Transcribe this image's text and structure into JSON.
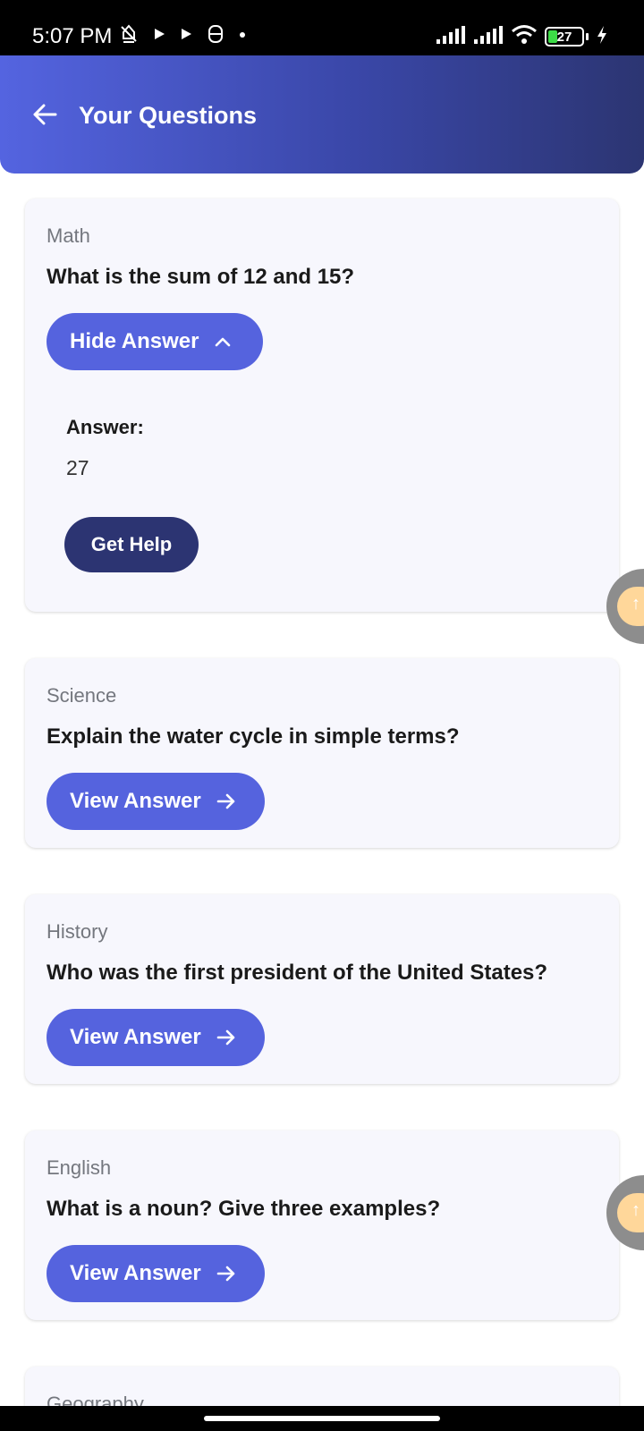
{
  "status_bar": {
    "time": "5:07 PM",
    "battery_level": "27",
    "icons": [
      "muted-alarm-icon",
      "play-icon",
      "play-icon",
      "sync-icon",
      "dot-icon",
      "signal-icon",
      "signal-icon",
      "wifi-icon",
      "battery-icon",
      "charging-icon"
    ]
  },
  "header": {
    "title": "Your Questions",
    "back_icon": "arrow-left-icon"
  },
  "colors": {
    "header_gradient_start": "#5464e0",
    "header_gradient_end": "#2c3572",
    "primary_button": "#5563de",
    "secondary_button": "#2c3472",
    "card_background": "#f7f7fd"
  },
  "questions": [
    {
      "subject": "Math",
      "question": "What is the sum of 12 and 15?",
      "button_label": "Hide Answer",
      "button_icon": "chevron-up-icon",
      "expanded": true,
      "answer_label": "Answer:",
      "answer_value": "27",
      "help_label": "Get Help"
    },
    {
      "subject": "Science",
      "question": "Explain the water cycle in simple terms?",
      "button_label": "View Answer",
      "button_icon": "arrow-right-icon",
      "expanded": false
    },
    {
      "subject": "History",
      "question": "Who was the first president of the United States?",
      "button_label": "View Answer",
      "button_icon": "arrow-right-icon",
      "expanded": false
    },
    {
      "subject": "English",
      "question": "What is a noun? Give three examples?",
      "button_label": "View Answer",
      "button_icon": "arrow-right-icon",
      "expanded": false
    },
    {
      "subject": "Geography",
      "expanded": false
    }
  ]
}
